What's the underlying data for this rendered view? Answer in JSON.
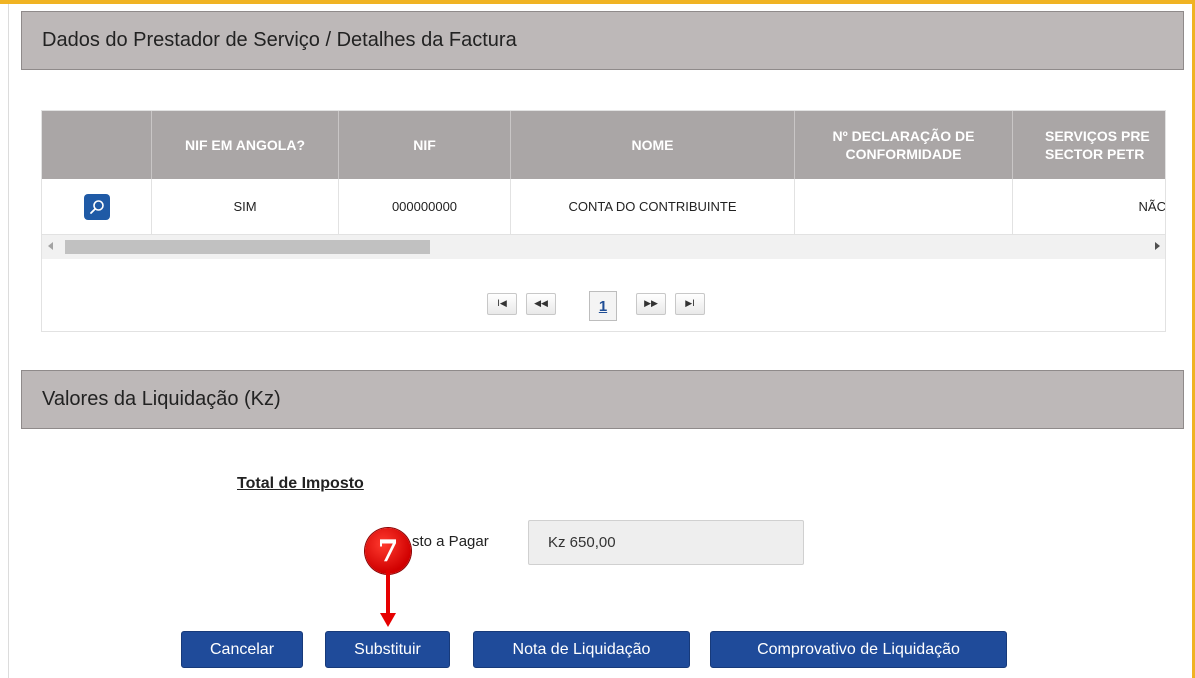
{
  "colors": {
    "accent": "#f0b323",
    "header_bg": "#bdb8b8",
    "table_head": "#aaa6a6",
    "button": "#1f4b9a",
    "marker": "#e60000"
  },
  "provider_section": {
    "title": "Dados do Prestador de Serviço / Detalhes da Factura"
  },
  "table": {
    "columns": [
      "",
      "NIF EM ANGOLA?",
      "NIF",
      "NOME",
      "Nº DECLARAÇÃO DE CONFORMIDADE",
      "SERVIÇOS PRE SECTOR PETR"
    ],
    "column_lines": {
      "declaracao": [
        "Nº DECLARAÇÃO DE",
        "CONFORMIDADE"
      ],
      "servicos": [
        "SERVIÇOS PRE",
        "SECTOR PETR"
      ]
    },
    "rows": [
      {
        "action_icon": "search-icon",
        "nif_em_angola": "SIM",
        "nif": "000000000",
        "nome": "CONTA DO CONTRIBUINTE",
        "declaracao": "",
        "servicos": "NÃC"
      }
    ]
  },
  "pager": {
    "first": "I◀",
    "prev": "◀◀",
    "current": "1",
    "next": "▶▶",
    "last": "▶I"
  },
  "values_section": {
    "title": "Valores da Liquidação (Kz)"
  },
  "totals": {
    "title": "Total de Imposto",
    "field_label": "sto a Pagar",
    "field_value": "Kz 650,00"
  },
  "annotation": {
    "step": "7"
  },
  "buttons": {
    "cancel": "Cancelar",
    "replace": "Substituir",
    "note": "Nota de Liquidação",
    "receipt": "Comprovativo de Liquidação"
  }
}
